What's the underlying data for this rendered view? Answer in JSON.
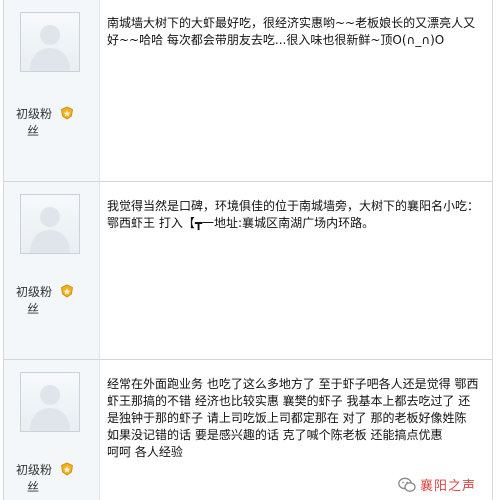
{
  "posts": [
    {
      "rank": "初级粉丝",
      "rank_line1": "初级粉",
      "rank_line2": "丝",
      "avatar_icon": "default-avatar-icon",
      "medal_icon": "rank-medal-icon",
      "content": "南城墙大树下的大虾最好吃，很经济实惠哟~~老板娘长的又漂亮人又好~~哈哈 每次都会带朋友去吃...很入味也很新鲜~顶O(∩_∩)O"
    },
    {
      "rank": "初级粉丝",
      "rank_line1": "初级粉",
      "rank_line2": "丝",
      "avatar_icon": "default-avatar-icon",
      "medal_icon": "rank-medal-icon",
      "content": "我觉得当然是口碑，环境俱佳的位于南城墙旁，大树下的襄阳名小吃：鄂西虾王 打入【┳一地址:襄城区南湖广场内环路。"
    },
    {
      "rank": "初级粉丝",
      "rank_line1": "初级粉",
      "rank_line2": "丝",
      "avatar_icon": "default-avatar-icon",
      "medal_icon": "rank-medal-icon",
      "content": "经常在外面跑业务 也吃了这么多地方了 至于虾子吧各人还是觉得 鄂西虾王那搞的不错 经济也比较实惠 襄樊的虾子 我基本上都去吃过了 还是独钟于那的虾子 请上司吃饭上司都定那在 对了 那的老板好像姓陈 如果没记错的话 要是感兴趣的话 克了喊个陈老板 还能搞点优惠\n呵呵 各人经验"
    }
  ],
  "watermark": {
    "text": "襄阳之声",
    "icon": "wechat-icon",
    "color": "#e04545"
  }
}
